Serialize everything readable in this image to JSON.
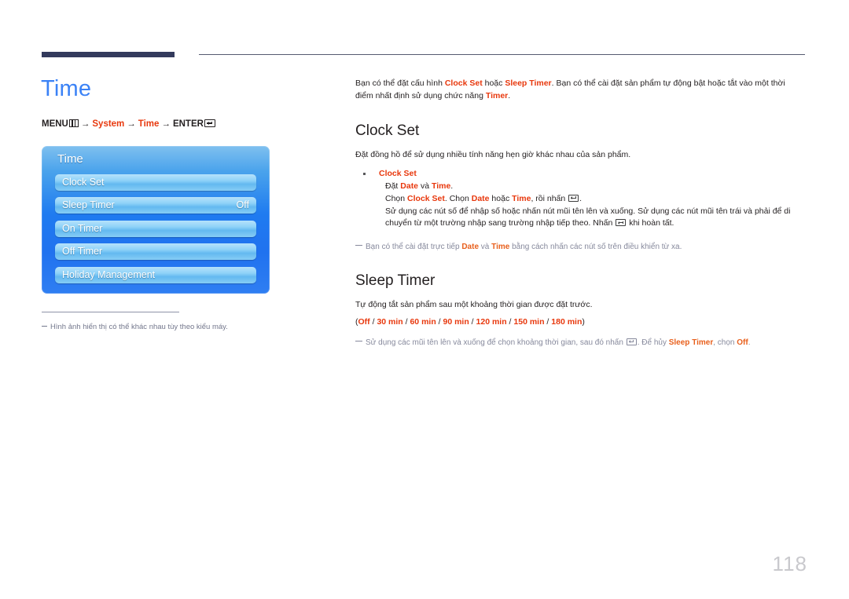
{
  "page": {
    "number": "118",
    "title": "Time"
  },
  "breadcrumb": {
    "menu_label": "MENU",
    "menu_icon": "menu-grid-icon",
    "arrow": "→",
    "step_system": "System",
    "step_time": "Time",
    "enter_label": "ENTER",
    "enter_icon": "enter-key-icon"
  },
  "osd": {
    "title": "Time",
    "rows": [
      {
        "label": "Clock Set",
        "value": ""
      },
      {
        "label": "Sleep Timer",
        "value": "Off"
      },
      {
        "label": "On Timer",
        "value": ""
      },
      {
        "label": "Off Timer",
        "value": ""
      },
      {
        "label": "Holiday Management",
        "value": ""
      }
    ]
  },
  "left_note": {
    "dash": "–",
    "text": "Hình ảnh hiển thị có thể khác nhau tùy theo kiểu máy."
  },
  "intro": {
    "t1": "Bạn có thể đặt cấu hình ",
    "r1": "Clock Set",
    "t2": " hoặc ",
    "r2": "Sleep Timer",
    "t3": ". Bạn có thể cài đặt sản phẩm tự động bật hoặc tắt vào một thời điểm nhất định sử dụng chức năng ",
    "r3": "Timer",
    "t4": "."
  },
  "clock_set": {
    "heading": "Clock Set",
    "intro": "Đặt đồng hồ để sử dụng nhiều tính năng hẹn giờ khác nhau của sản phẩm.",
    "bullet_title": "Clock Set",
    "line1_a": "Đặt ",
    "line1_r1": "Date",
    "line1_b": " và ",
    "line1_r2": "Time",
    "line1_c": ".",
    "line2_a": "Chọn ",
    "line2_r1": "Clock Set",
    "line2_b": ". Chọn ",
    "line2_r2": "Date",
    "line2_c": " hoặc ",
    "line2_r3": "Time",
    "line2_d": ", rồi nhấn ",
    "line2_e": ".",
    "line3_a": "Sử dụng các nút số để nhập số hoặc nhấn nút mũi tên lên và xuống. Sử dụng các nút mũi tên trái và phải để di chuyển từ một trường nhập sang trường nhập tiếp theo. Nhấn ",
    "line3_b": " khi hoàn tất.",
    "note_a": "Bạn có thể cài đặt trực tiếp ",
    "note_r1": "Date",
    "note_b": " và ",
    "note_r2": "Time",
    "note_c": " bằng cách nhấn các nút số trên điều khiển từ xa."
  },
  "sleep_timer": {
    "heading": "Sleep Timer",
    "intro": "Tự động tắt sản phẩm sau một khoảng thời gian được đặt trước.",
    "options_open": "(",
    "options": [
      "Off",
      "30 min",
      "60 min",
      "90 min",
      "120 min",
      "150 min",
      "180 min"
    ],
    "options_sep": " / ",
    "options_close": ")",
    "note_a": "Sử dụng các mũi tên lên và xuống để chọn khoảng thời gian, sau đó nhấn ",
    "note_b": ". Để hủy ",
    "note_r1": "Sleep Timer",
    "note_c": ", chọn ",
    "note_r2": "Off",
    "note_d": "."
  },
  "colors": {
    "accent_blue": "#3b82f6",
    "accent_red": "#e8380d",
    "rule_navy": "#333a5c",
    "note_grey": "#86899c",
    "page_num_grey": "#c9c9cd"
  }
}
